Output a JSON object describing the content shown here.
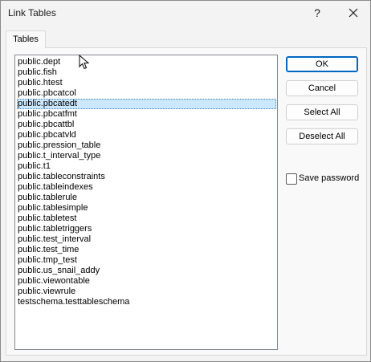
{
  "window": {
    "title": "Link Tables",
    "help_glyph": "?"
  },
  "tabs": [
    {
      "label": "Tables"
    }
  ],
  "tables_list": {
    "items": [
      "public.dept",
      "public.fish",
      "public.htest",
      "public.pbcatcol",
      "public.pbcatedt",
      "public.pbcatfmt",
      "public.pbcattbl",
      "public.pbcatvld",
      "public.pression_table",
      "public.t_interval_type",
      "public.t1",
      "public.tableconstraints",
      "public.tableindexes",
      "public.tablerule",
      "public.tablesimple",
      "public.tabletest",
      "public.tabletriggers",
      "public.test_interval",
      "public.test_time",
      "public.tmp_test",
      "public.us_snail_addy",
      "public.viewontable",
      "public.viewrule",
      "testschema.testtableschema"
    ],
    "selected_index": 4
  },
  "buttons": {
    "ok": "OK",
    "cancel": "Cancel",
    "select_all": "Select All",
    "deselect_all": "Deselect All"
  },
  "save_password": {
    "label": "Save password",
    "checked": false
  },
  "colors": {
    "selection": "#cce8ff",
    "default_button_border": "#0067c0"
  },
  "icons": {
    "close": "close-icon",
    "help": "help-icon",
    "cursor": "mouse-pointer-icon"
  }
}
